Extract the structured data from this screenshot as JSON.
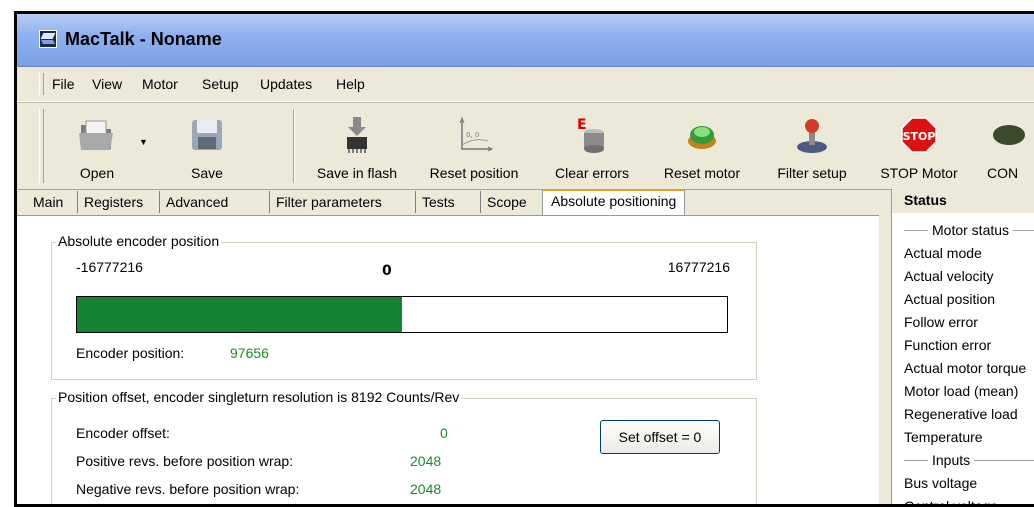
{
  "window": {
    "title": "MacTalk - Noname"
  },
  "menu": [
    "File",
    "View",
    "Motor",
    "Setup",
    "Updates",
    "Help"
  ],
  "toolbar": {
    "open": "Open",
    "save": "Save",
    "save_in_flash": "Save in flash",
    "reset_position": "Reset position",
    "clear_errors": "Clear errors",
    "reset_motor": "Reset motor",
    "filter_setup": "Filter setup",
    "stop_motor": "STOP Motor",
    "stop_sign": "STOP",
    "con": "CON"
  },
  "tabs": [
    "Main",
    "Registers",
    "Advanced",
    "Filter parameters",
    "Tests",
    "Scope",
    "Absolute positioning"
  ],
  "absolute_encoder": {
    "title": "Absolute encoder position",
    "min": "-16777216",
    "center": "0",
    "max": "16777216",
    "fill_fraction": 0.5,
    "position_label": "Encoder position:",
    "position_value": "97656"
  },
  "offset_group": {
    "title": "Position offset, encoder singleturn resolution is 8192 Counts/Rev",
    "encoder_offset_label": "Encoder offset:",
    "encoder_offset_value": "0",
    "pos_revs_label": "Positive revs. before position wrap:",
    "pos_revs_value": "2048",
    "neg_revs_label": "Negative revs. before position wrap:",
    "neg_revs_value": "2048",
    "set_offset_button": "Set offset = 0"
  },
  "status": {
    "title": "Status",
    "motor_status_header": "Motor status",
    "motor_items": [
      "Actual mode",
      "Actual velocity",
      "Actual position",
      "Follow error",
      "Function error",
      "Actual motor torque",
      "Motor load (mean)",
      "Regenerative load",
      "Temperature"
    ],
    "inputs_header": "Inputs",
    "input_items": [
      "Bus voltage",
      "Control voltage"
    ]
  },
  "colors": {
    "progress_fill": "#168233",
    "value_text": "#1f8a2a",
    "title_bar": "#8fb0ef"
  }
}
